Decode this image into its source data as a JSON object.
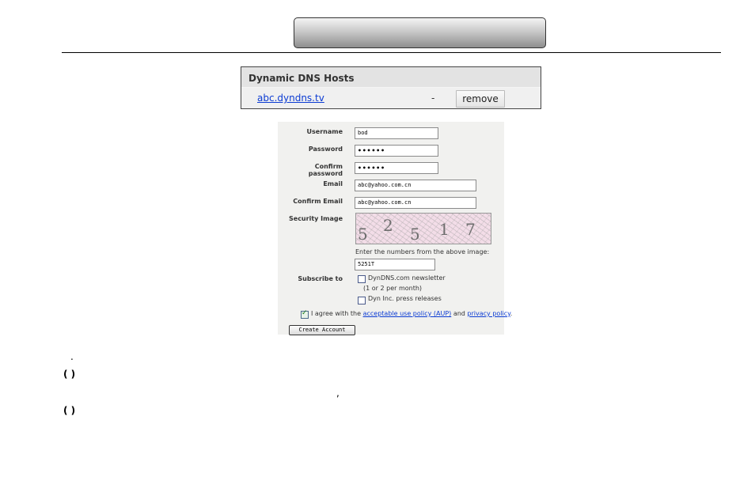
{
  "ddns": {
    "heading": "Dynamic DNS Hosts",
    "host": "abc.dyndns.tv",
    "dash": "-",
    "remove_label": "remove"
  },
  "form": {
    "labels": {
      "username": "Username",
      "password": "Password",
      "confirm_password": "Confirm password",
      "email": "Email",
      "confirm_email": "Confirm Email",
      "security_image": "Security Image",
      "subscribe": "Subscribe to"
    },
    "values": {
      "username": "bod",
      "password": "••••••",
      "confirm_password": "••••••",
      "email": "abc@yahoo.com.cn",
      "confirm_email": "abc@yahoo.com.cn",
      "captcha_answer": "5251T"
    },
    "captcha_digits": [
      "5",
      "2",
      "5",
      "1",
      "7"
    ],
    "captcha_hint": "Enter the numbers from the above image:",
    "subscriptions": [
      {
        "label": "DynDNS.com newsletter",
        "checked": false
      },
      {
        "label": "Dyn Inc. press releases",
        "checked": false
      }
    ],
    "newsletter_note": "(1 or 2 per month)",
    "agree": {
      "prefix": "I agree with the ",
      "aup_link": "acceptable use policy (AUP)",
      "and": " and ",
      "privacy_link": "privacy policy",
      "suffix": ".",
      "checked": true
    },
    "create_label": "Create Account"
  },
  "doc_marks": {
    "dot": ".",
    "paren1": "(   )",
    "comma": ",",
    "paren2": "(   )"
  }
}
